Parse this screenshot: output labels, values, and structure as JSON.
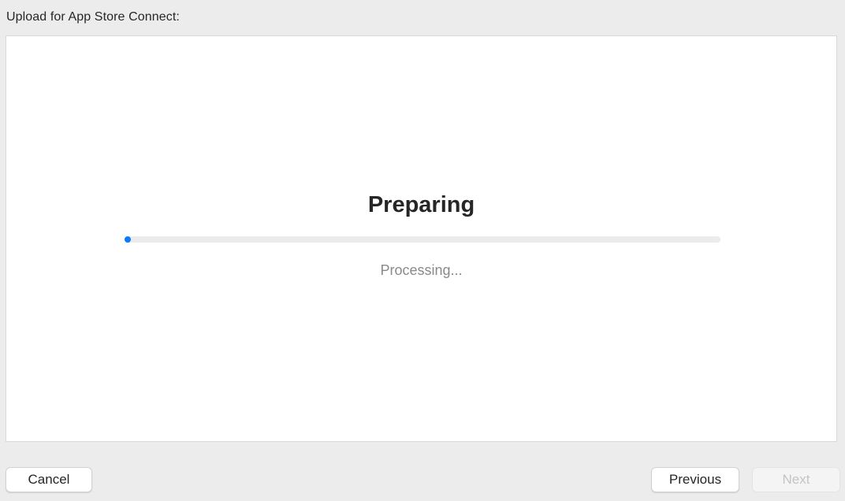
{
  "header": {
    "title": "Upload for App Store Connect:"
  },
  "status": {
    "title": "Preparing",
    "detail": "Processing...",
    "progress_fraction": 0.0
  },
  "buttons": {
    "cancel_label": "Cancel",
    "previous_label": "Previous",
    "next_label": "Next",
    "next_enabled": false
  },
  "colors": {
    "accent": "#0a7aff",
    "track": "#ebebeb",
    "panel": "#ffffff",
    "window": "#ececec"
  }
}
